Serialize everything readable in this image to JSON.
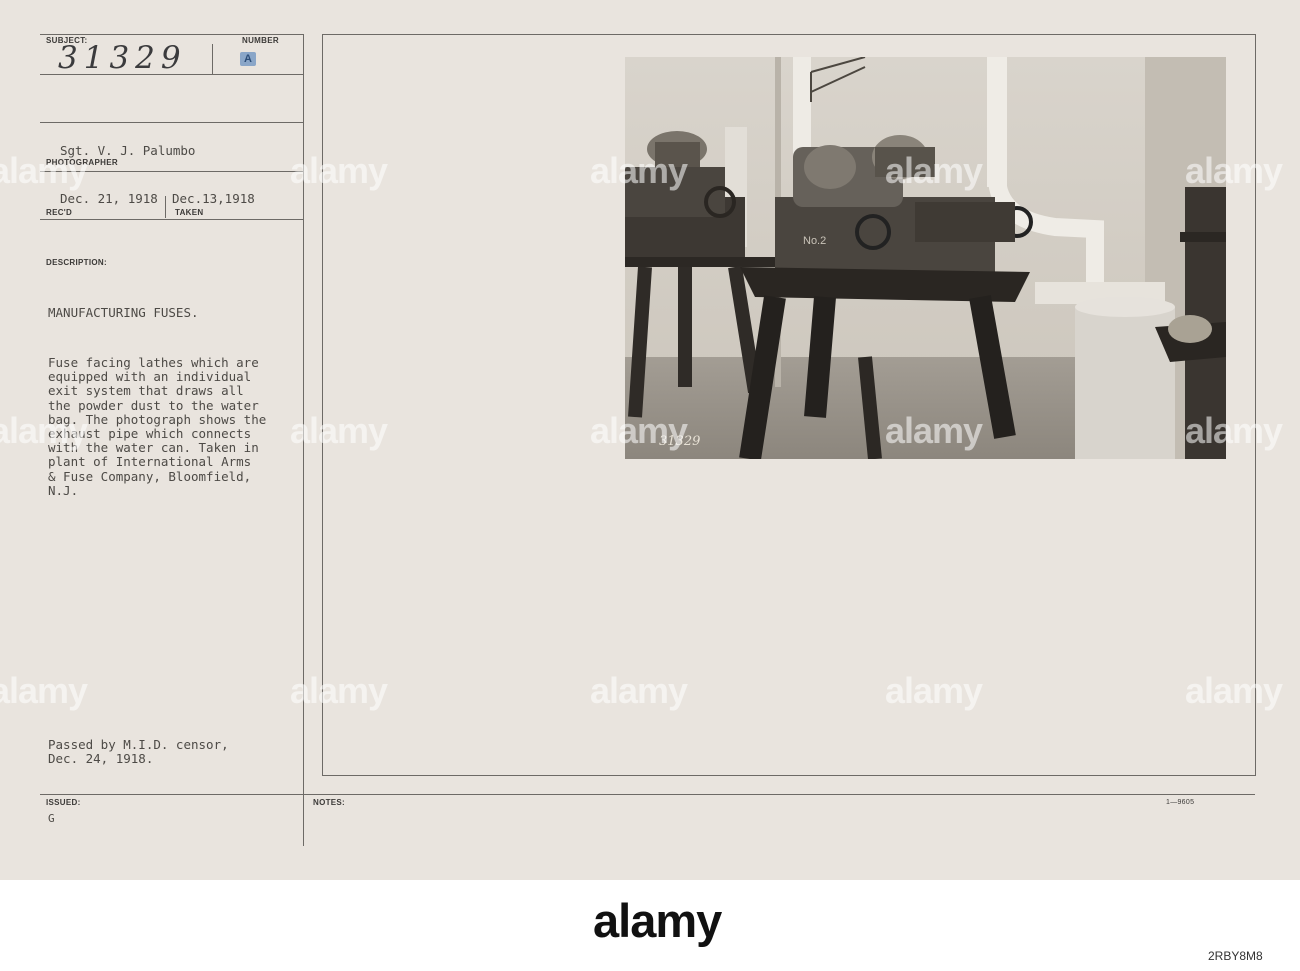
{
  "card": {
    "subject_label": "SUBJECT:",
    "number_label": "NUMBER",
    "subject_number": "31329",
    "number_mark": "A",
    "photographer": "Sgt. V. J. Palumbo",
    "photographer_label": "PHOTOGRAPHER",
    "received_date": "Dec. 21, 1918",
    "taken_date": "Dec.13,1918",
    "received_label": "REC'D",
    "taken_label": "TAKEN",
    "description_label": "DESCRIPTION:",
    "title": "MANUFACTURING FUSES.",
    "description_lines": [
      "Fuse facing lathes which are",
      "equipped with an individual",
      "exit system that draws all",
      "the powder dust to the water",
      "bag. The photograph shows the",
      "exhaust pipe which connects",
      "with the water can. Taken in",
      "plant of International Arms",
      "& Fuse Company, Bloomfield,",
      "N.J."
    ],
    "censor_line1": "Passed by M.I.D. censor,",
    "censor_line2": "Dec. 24, 1918.",
    "issued_label": "ISSUED:",
    "issued_value": "G",
    "notes_label": "NOTES:",
    "form_number": "1—9605"
  },
  "photo": {
    "machine_label": "No.2",
    "negative_number": "31329"
  },
  "watermark": "alamy",
  "footer": {
    "brand": "alamy",
    "image_id": "2RBY8M8"
  }
}
